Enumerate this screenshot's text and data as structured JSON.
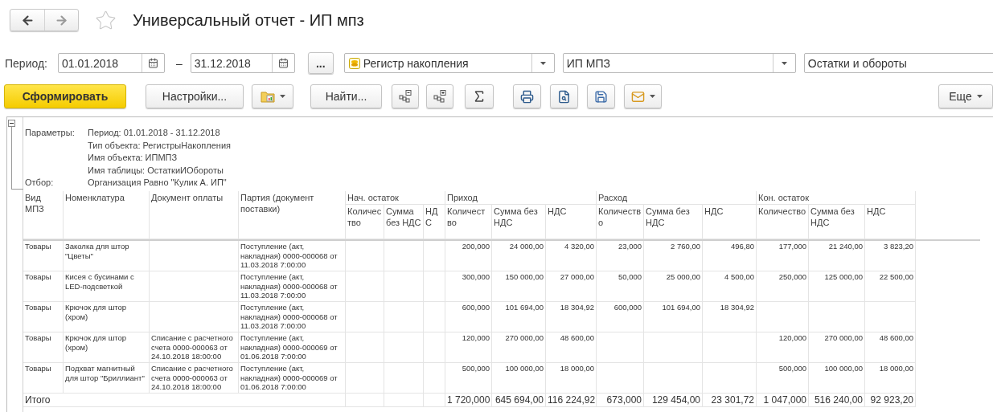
{
  "window": {
    "title": "Универсальный отчет - ИП мпз"
  },
  "period": {
    "label": "Период:",
    "from": "01.01.2018",
    "separator": "–",
    "to": "31.12.2018",
    "more": "..."
  },
  "selectors": [
    {
      "value": "Регистр накопления",
      "kind": "register"
    },
    {
      "value": "ИП МПЗ",
      "kind": "list"
    },
    {
      "value": "Остатки и обороты",
      "kind": "text"
    }
  ],
  "toolbar": {
    "generate": "Сформировать",
    "settings": "Настройки...",
    "find": "Найти...",
    "more": "Еще"
  },
  "report": {
    "expanded": true,
    "parameters": [
      {
        "label": "Параметры:",
        "values": [
          "Период: 01.01.2018 - 31.12.2018",
          "Тип объекта: РегистрыНакопления",
          "Имя объекта: ИПМПЗ",
          "Имя таблицы: ОстаткиИОбороты"
        ]
      },
      {
        "label": "Отбор:",
        "values": [
          "Организация Равно \"Кулик А. ИП\""
        ]
      }
    ]
  },
  "table": {
    "columns": [
      {
        "label": "Вид МПЗ",
        "kind": "main"
      },
      {
        "label": "Номенклатура",
        "kind": "main"
      },
      {
        "label": "Документ оплаты",
        "kind": "main"
      },
      {
        "label": "Партия (документ поставки)",
        "kind": "main"
      },
      {
        "label": "Количество",
        "kind": "sub",
        "group": "Нач. остаток"
      },
      {
        "label": "Сумма без НДС",
        "kind": "sub"
      },
      {
        "label": "НДС",
        "kind": "sub"
      },
      {
        "label": "Количество",
        "kind": "sub",
        "group": "Приход"
      },
      {
        "label": "Сумма без НДС",
        "kind": "sub"
      },
      {
        "label": "НДС",
        "kind": "sub"
      },
      {
        "label": "Количество",
        "kind": "sub",
        "group": "Расход"
      },
      {
        "label": "Сумма без НДС",
        "kind": "sub"
      },
      {
        "label": "НДС",
        "kind": "sub"
      },
      {
        "label": "Количество",
        "kind": "sub",
        "group": "Кон. остаток"
      },
      {
        "label": "Сумма без НДС",
        "kind": "sub"
      },
      {
        "label": "НДС",
        "kind": "sub"
      }
    ],
    "rows": [
      {
        "cells": [
          "Товары",
          "Заколка для штор \"Цветы\"",
          null,
          "Поступление (акт, накладная) 0000-000068 от 11.03.2018 7:00:00",
          null,
          null,
          null,
          "200,000",
          "24 000,00",
          "4 320,00",
          "23,000",
          "2 760,00",
          "496,80",
          "177,000",
          "21 240,00",
          "3 823,20"
        ]
      },
      {
        "cells": [
          "Товары",
          "Кисея с бусинами с LED-подсветкой",
          null,
          "Поступление (акт, накладная) 0000-000068 от 11.03.2018 7:00:00",
          null,
          null,
          null,
          "300,000",
          "150 000,00",
          "27 000,00",
          "50,000",
          "25 000,00",
          "4 500,00",
          "250,000",
          "125 000,00",
          "22 500,00"
        ]
      },
      {
        "cells": [
          "Товары",
          "Крючок для штор (хром)",
          null,
          "Поступление (акт, накладная) 0000-000068 от 11.03.2018 7:00:00",
          null,
          null,
          null,
          "600,000",
          "101 694,00",
          "18 304,92",
          "600,000",
          "101 694,00",
          "18 304,92",
          null,
          null,
          null
        ]
      },
      {
        "cells": [
          "Товары",
          "Крючок для штор (хром)",
          "Списание с расчетного счета 0000-000063 от 24.10.2018 18:00:00",
          "Поступление (акт, накладная) 0000-000069 от 01.06.2018 7:00:00",
          null,
          null,
          null,
          "120,000",
          "270 000,00",
          "48 600,00",
          null,
          null,
          null,
          "120,000",
          "270 000,00",
          "48 600,00"
        ]
      },
      {
        "cells": [
          "Товары",
          "Подхват магнитный для штор \"Бриллиант\"",
          "Списание с расчетного счета 0000-000063 от 24.10.2018 18:00:00",
          "Поступление (акт, накладная) 0000-000069 от 01.06.2018 7:00:00",
          null,
          null,
          null,
          "500,000",
          "100 000,00",
          "18 000,00",
          null,
          null,
          null,
          "500,000",
          "100 000,00",
          "18 000,00"
        ]
      }
    ],
    "total": {
      "label": "Итого",
      "cells": [
        null,
        null,
        null,
        "1 720,000",
        "645 694,00",
        "116 224,92",
        "673,000",
        "129 454,00",
        "23 301,72",
        "1 047,000",
        "516 240,00",
        "92 923,20"
      ]
    }
  }
}
